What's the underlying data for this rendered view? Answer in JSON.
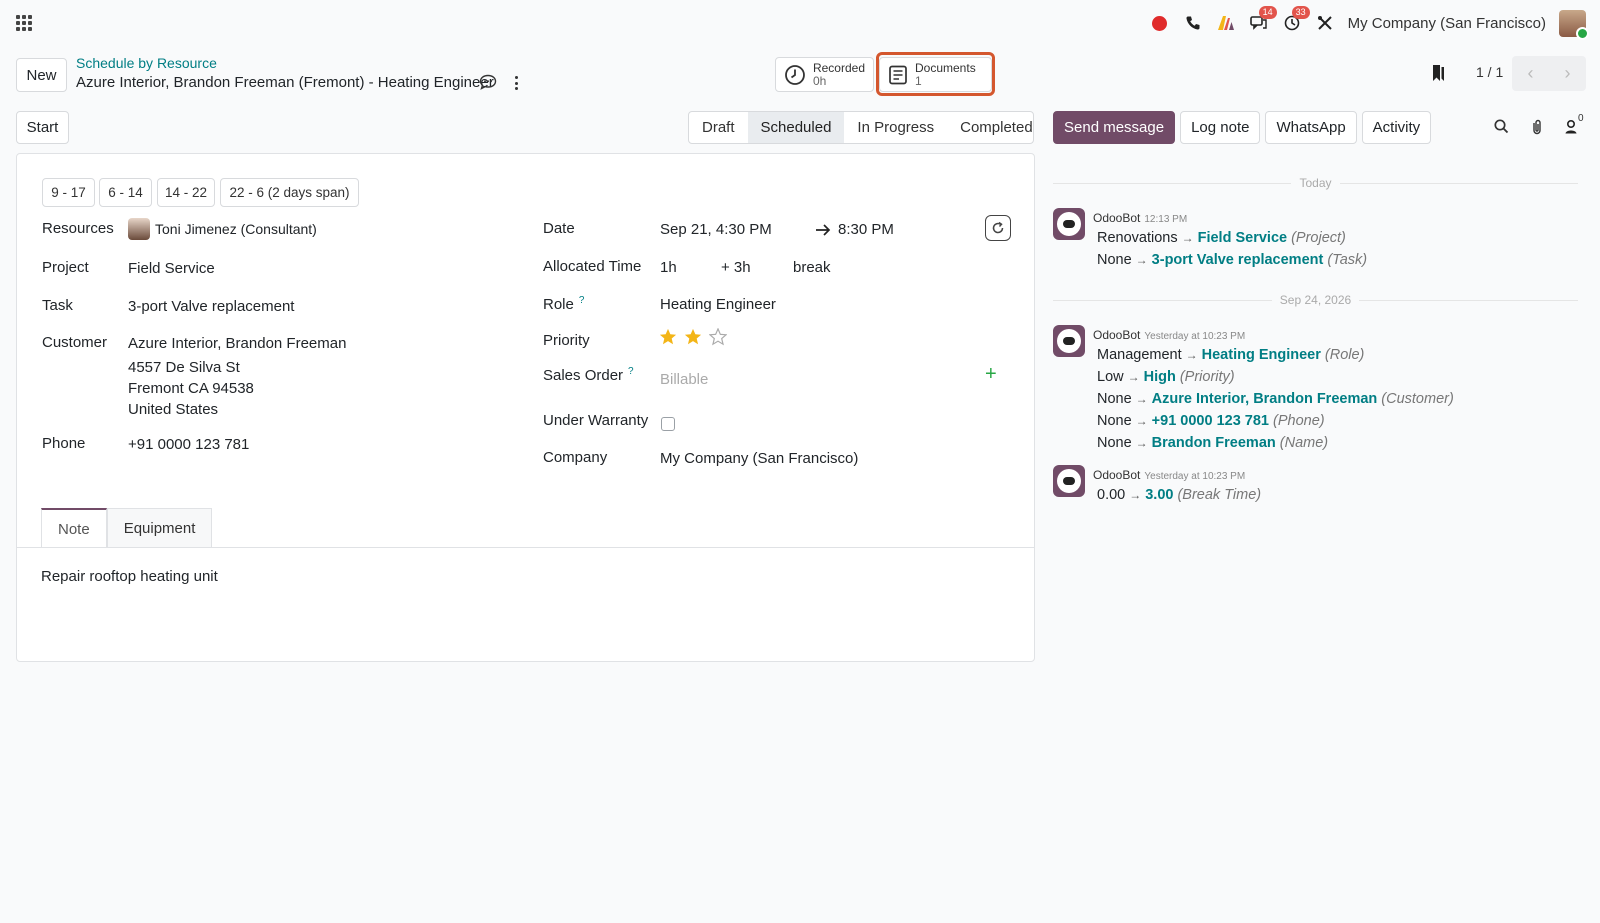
{
  "navbar": {
    "company": "My Company (San Francisco)",
    "messages_badge": "14",
    "activities_badge": "33"
  },
  "control": {
    "new_label": "New",
    "breadcrumb_parent": "Schedule by Resource",
    "record_title": "Azure Interior, Brandon Freeman (Fremont) - Heating Engineer",
    "smart_recorded_label": "Recorded",
    "smart_recorded_value": "0h",
    "smart_documents_label": "Documents",
    "smart_documents_value": "1",
    "pager": "1 / 1"
  },
  "statusbar": {
    "start_label": "Start",
    "stages": [
      "Draft",
      "Scheduled",
      "In Progress",
      "Completed"
    ],
    "active_stage": "Scheduled"
  },
  "form": {
    "shifts": [
      "9 - 17",
      "6 - 14",
      "14 - 22",
      "22 - 6 (2 days span)"
    ],
    "resources_label": "Resources",
    "resources_value": "Toni Jimenez (Consultant)",
    "project_label": "Project",
    "project_value": "Field Service",
    "task_label": "Task",
    "task_value": "3-port Valve replacement",
    "customer_label": "Customer",
    "customer_name": "Azure Interior, Brandon Freeman",
    "customer_street": "4557 De Silva St",
    "customer_city": "Fremont CA 94538",
    "customer_country": "United States",
    "phone_label": "Phone",
    "phone_value": "+91 0000 123 781",
    "date_label": "Date",
    "date_start": "Sep 21, 4:30 PM",
    "date_end": "8:30 PM",
    "allocated_label": "Allocated Time",
    "allocated_value": "1h",
    "allocated_extra": "+ 3h",
    "allocated_break": "break",
    "role_label": "Role",
    "role_value": "Heating Engineer",
    "priority_label": "Priority",
    "priority_stars": 2,
    "priority_max": 3,
    "sales_order_label": "Sales Order",
    "sales_order_placeholder": "Billable",
    "warranty_label": "Under Warranty",
    "company_label": "Company",
    "company_value": "My Company (San Francisco)",
    "help_mark": "?"
  },
  "tabs": {
    "note": "Note",
    "equipment": "Equipment",
    "note_text": "Repair rooftop heating unit"
  },
  "chatter": {
    "send_message": "Send message",
    "log_note": "Log note",
    "whatsapp": "WhatsApp",
    "activity": "Activity",
    "followers_count": "0",
    "divider_today": "Today",
    "divider_date": "Sep 24, 2026",
    "messages": [
      {
        "author": "OdooBot",
        "time": "12:13 PM",
        "changes": [
          {
            "old": "Renovations",
            "new": "Field Service",
            "field": "(Project)"
          },
          {
            "old": "None",
            "new": "3-port Valve replacement",
            "field": "(Task)"
          }
        ]
      },
      {
        "author": "OdooBot",
        "time": "Yesterday at 10:23 PM",
        "changes": [
          {
            "old": "Management",
            "new": "Heating Engineer",
            "field": "(Role)"
          },
          {
            "old": "Low",
            "new": "High",
            "field": "(Priority)"
          },
          {
            "old": "None",
            "new": "Azure Interior, Brandon Freeman",
            "field": "(Customer)"
          },
          {
            "old": "None",
            "new": "+91 0000 123 781",
            "field": "(Phone)"
          },
          {
            "old": "None",
            "new": "Brandon Freeman",
            "field": "(Name)"
          }
        ]
      },
      {
        "author": "OdooBot",
        "time": "Yesterday at 10:23 PM",
        "changes": [
          {
            "old": "0.00",
            "new": "3.00",
            "field": "(Break Time)"
          }
        ]
      }
    ]
  },
  "colors": {
    "brand": "#714b67",
    "link": "#017e84",
    "highlight": "#d4572e",
    "star": "#f3b517"
  }
}
